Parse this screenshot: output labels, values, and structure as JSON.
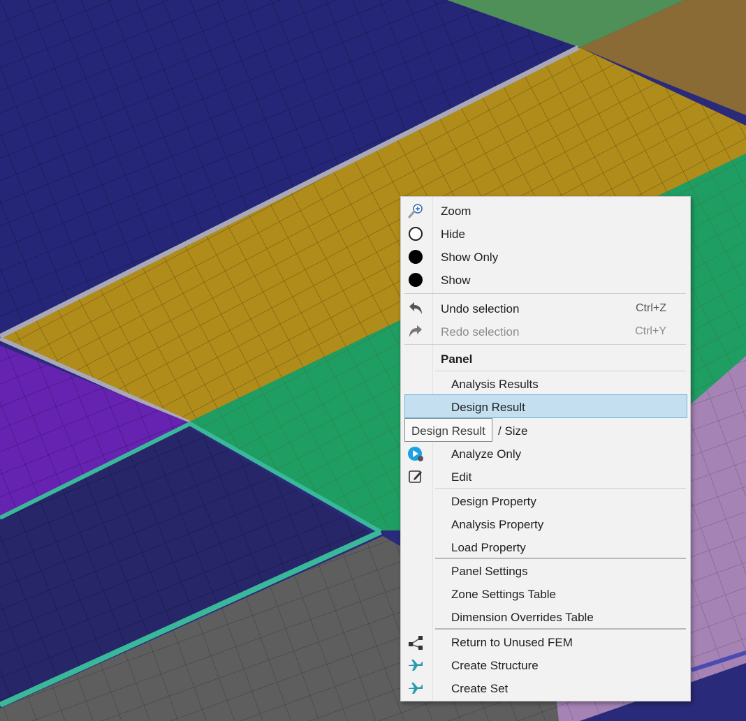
{
  "menu": {
    "view_items": [
      {
        "label": "Zoom",
        "icon": "zoom-icon"
      },
      {
        "label": "Hide",
        "icon": "hollow-circle-icon"
      },
      {
        "label": "Show Only",
        "icon": "filled-circle-icon"
      },
      {
        "label": "Show",
        "icon": "filled-circle-icon"
      }
    ],
    "history": {
      "undo": {
        "label": "Undo selection",
        "shortcut": "Ctrl+Z",
        "icon": "undo-arrow-icon"
      },
      "redo": {
        "label": "Redo selection",
        "shortcut": "Ctrl+Y",
        "icon": "redo-arrow-icon",
        "disabled": true
      }
    },
    "panel_header": "Panel",
    "results": [
      "Analysis Results",
      "Design Result"
    ],
    "size_item": "/ Size",
    "analyze_only": "Analyze Only",
    "edit": "Edit",
    "properties": [
      "Design Property",
      "Analysis Property",
      "Load Property"
    ],
    "settings": [
      "Panel Settings",
      "Zone Settings Table",
      "Dimension Overrides Table"
    ],
    "actions": [
      {
        "label": "Return to Unused FEM",
        "icon": "node-link-icon"
      },
      {
        "label": "Create Structure",
        "icon": "airplane-icon"
      },
      {
        "label": "Create Set",
        "icon": "airplane-icon"
      }
    ],
    "highlighted": "Design Result"
  },
  "tooltip": {
    "text": "Design Result"
  },
  "colors": {
    "navy": "#2a2a7a",
    "gold": "#b08c1b",
    "green": "#1e9e62",
    "purple": "#6622b0",
    "gray": "#5e5e5e",
    "lavender": "#a583b5",
    "brown": "#8a6a35",
    "teal": "#3ab89a",
    "highlight": "#c3dff0",
    "accent": "#1ba1e2"
  }
}
